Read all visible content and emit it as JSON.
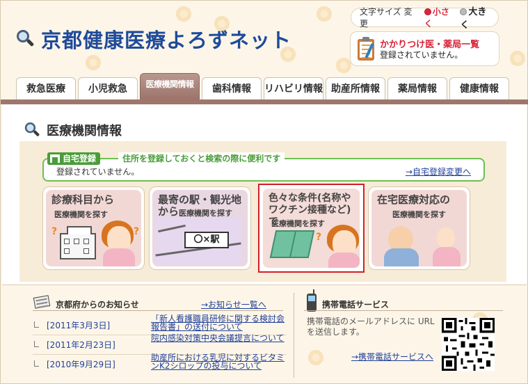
{
  "header": {
    "site_title": "京都健康医療よろずネット",
    "fontsize": {
      "label": "文字サイズ 変更",
      "small": "小さく",
      "large": "大きく"
    },
    "kakaritsuke": {
      "title": "かかりつけ医・薬局一覧",
      "status": "登録されていません。"
    }
  },
  "tabs": [
    {
      "label": "救急医療"
    },
    {
      "label": "小児救急"
    },
    {
      "label": "医療機関情報"
    },
    {
      "label": "歯科情報"
    },
    {
      "label": "リハビリ情報"
    },
    {
      "label": "助産所情報"
    },
    {
      "label": "薬局情報"
    },
    {
      "label": "健康情報"
    }
  ],
  "main": {
    "section_title": "医療機関情報",
    "home": {
      "tag": "自宅登録",
      "desc": "住所を登録しておくと検索の際に便利です",
      "status": "登録されていません。",
      "link": "→自宅登録変更へ"
    },
    "cards": [
      {
        "title": "診療科目から",
        "sub": "医療機関を探す"
      },
      {
        "title": "最寄の駅・観光地",
        "title2": "から",
        "sub": "医療機関を探す",
        "sign": "〇×駅"
      },
      {
        "title": "色々な条件(名称や",
        "title2": "ワクチン接種など)で",
        "sub": "医療機関を探す"
      },
      {
        "title": "在宅医療対応の",
        "sub": "医療機関を探す"
      }
    ]
  },
  "notice": {
    "title": "京都府からのお知らせ",
    "more": "→お知らせ一覧へ",
    "items": [
      {
        "date": "[2011年3月3日]",
        "text": "「新人看護職員研修に関する検討会報告書」の送付について"
      },
      {
        "date": "[2011年2月23日]",
        "text": "院内感染対策中央会議提言について"
      },
      {
        "date": "[2010年9月29日]",
        "text": "助産所における乳児に対するビタミンK2シロップの投与について"
      }
    ]
  },
  "mobile": {
    "title": "携帯電話サービス",
    "desc": "携帯電話のメールアドレスに URL を送信します。",
    "link": "→携帯電話サービスへ"
  },
  "colors": {
    "brand_blue": "#1f4a9a",
    "tab_active": "#9f766c",
    "highlight_red": "#d0202a",
    "home_green": "#4a9d3a"
  }
}
